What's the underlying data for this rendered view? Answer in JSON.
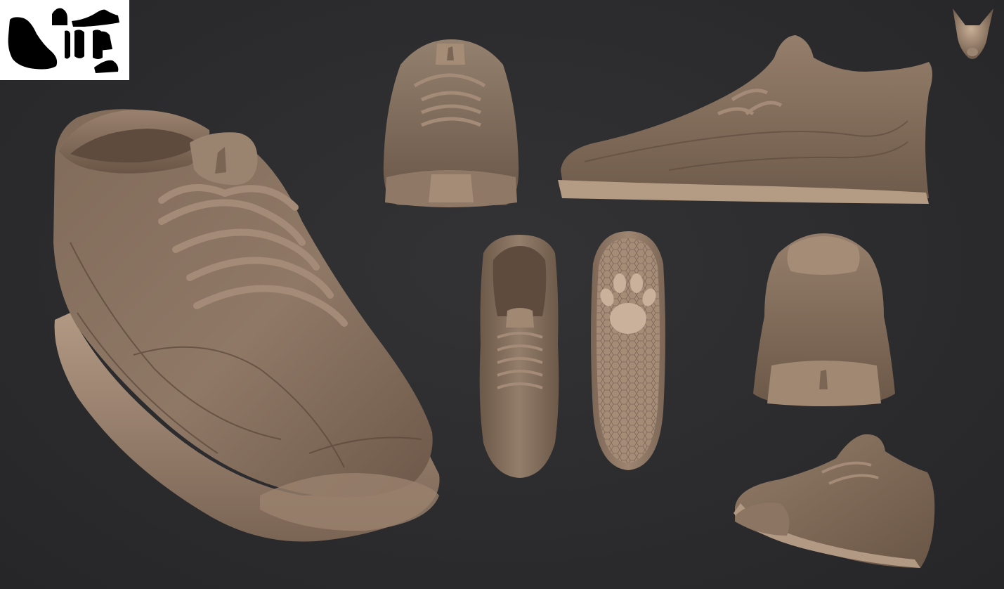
{
  "colors": {
    "background": "#2b2b2d",
    "clay": "#8d7563",
    "clay_light": "#b59c85",
    "clay_dark": "#5e4c40",
    "sole": "#a28b76",
    "thumbnail_bg": "#ffffff",
    "thumbnail_silhouette": "#000000"
  },
  "icons": {
    "thumbnail_panel": "silhouette-thumbnail-icon",
    "navigation": "wolf-head-navigation-icon",
    "outsole_emblem": "paw-print-icon",
    "tongue_logo": "wolf-logo-icon"
  },
  "views": [
    "hero-three-quarter-view",
    "front-view",
    "side-profile-view",
    "top-view",
    "outsole-bottom-view",
    "back-view",
    "low-angle-three-quarter-view"
  ]
}
